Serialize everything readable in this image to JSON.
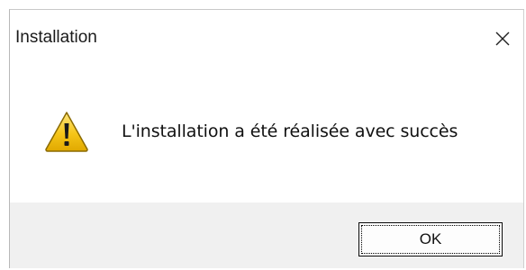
{
  "dialog": {
    "title": "Installation",
    "close_icon": "close-icon",
    "message": "L'installation a été réalisée avec succès",
    "icon": "warning-icon",
    "ok_label": "OK"
  },
  "colors": {
    "footer_background": "#f0f0f0",
    "warning_fill": "#f5c518",
    "warning_outline": "#8a6a00"
  }
}
